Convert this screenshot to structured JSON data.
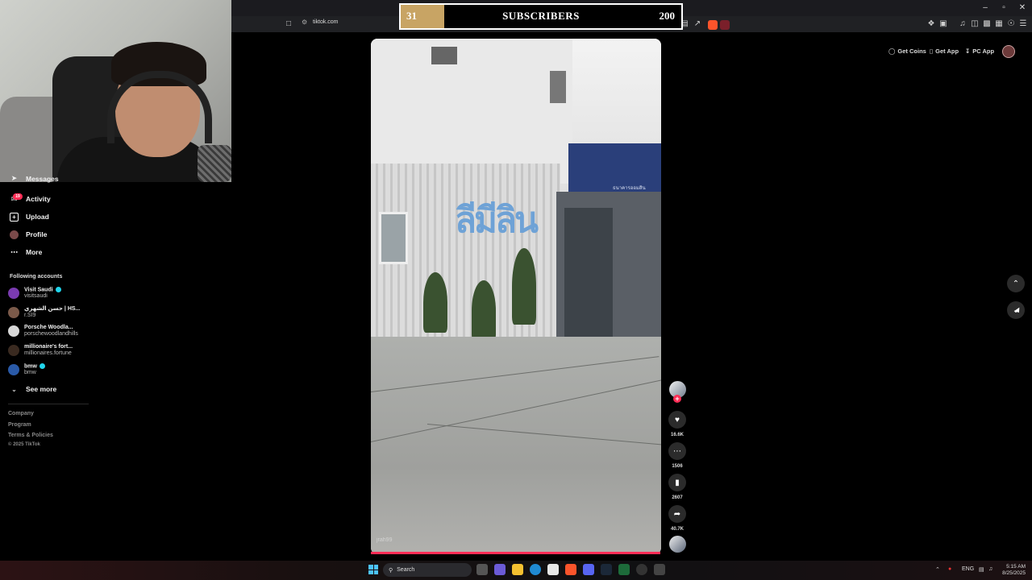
{
  "browser": {
    "url": "tiktok.com",
    "window_controls": [
      "–",
      "▫",
      "✕"
    ]
  },
  "overlay": {
    "current": "31",
    "label": "SUBSCRIBERS",
    "goal": "200",
    "progress_fraction": 0.155
  },
  "sidebar": {
    "items": [
      {
        "label": "Messages",
        "icon": "message-icon"
      },
      {
        "label": "Activity",
        "icon": "bell-icon",
        "badge": "19"
      },
      {
        "label": "Upload",
        "icon": "plus-square-icon"
      },
      {
        "label": "Profile",
        "icon": "avatar-icon"
      },
      {
        "label": "More",
        "icon": "ellipsis-icon"
      }
    ],
    "following_heading": "Following accounts",
    "accounts": [
      {
        "name": "Visit Saudi",
        "user": "visitsaudi",
        "verified": true,
        "color": "#7a3bb0"
      },
      {
        "name": "حسن الشهري | HS...",
        "user": "r.SI9",
        "verified": false,
        "color": "#7b5a4a"
      },
      {
        "name": "Porsche Woodla...",
        "user": "porschewoodlandhills",
        "verified": false,
        "color": "#d8d8d8"
      },
      {
        "name": "millionaire's fort...",
        "user": "millionaires.fortune",
        "verified": false,
        "color": "#3a2a20"
      },
      {
        "name": "bmw",
        "user": "bmw",
        "verified": true,
        "color": "#2a5aa8"
      }
    ],
    "see_more": "See more",
    "footer": [
      "Company",
      "Program",
      "Terms & Policies",
      "© 2025 TikTok"
    ]
  },
  "video": {
    "sign_text": "ลีมีลิน",
    "bank_text": "ธนาคารออมสิน",
    "watermark": "jrah99"
  },
  "actions": {
    "like_count": "16.6K",
    "comment_count": "1506",
    "save_count": "2607",
    "share_count": "40.7K"
  },
  "top_links": {
    "get_coins": "Get Coins",
    "get_app": "Get App",
    "pc_app": "PC App"
  },
  "taskbar": {
    "search_placeholder": "Search",
    "lang": "ENG",
    "time": "5:15 AM",
    "date": "8/25/2025"
  },
  "colors": {
    "accent": "#fe2c55",
    "verified": "#20d5ec",
    "overlay_fill": "#c8a464"
  }
}
